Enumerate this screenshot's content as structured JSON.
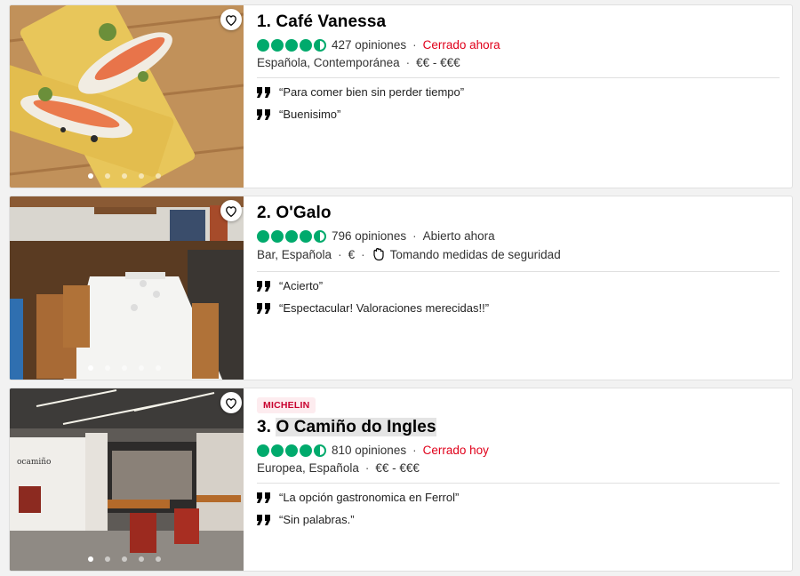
{
  "restaurants": [
    {
      "title": "1. Café Vanessa",
      "reviews": "427 opiniones",
      "status": "Cerrado ahora",
      "cuisine": "Española, Contemporánea",
      "price": "€€ - €€€",
      "quotes": [
        "“Para comer bien sin perder tiempo”",
        "“Buenisimo”"
      ]
    },
    {
      "title": "2. O'Galo",
      "reviews": "796 opiniones",
      "status": "Abierto ahora",
      "cuisine": "Bar, Española",
      "price": "€",
      "safety": "Tomando medidas de seguridad",
      "quotes": [
        "“Acierto”",
        "“Espectacular! Valoraciones merecidas!!”"
      ]
    },
    {
      "badge": "MICHELIN",
      "title_prefix": "3. ",
      "title_name": "O Camiño do Ingles",
      "reviews": "810 opiniones",
      "status": "Cerrado hoy",
      "cuisine": "Europea, Española",
      "price": "€€ - €€€",
      "quotes": [
        "“La opción gastronomica en Ferrol”",
        "“Sin palabras.”"
      ]
    }
  ],
  "separator": "·",
  "colors": {
    "rating_green": "#00aa6c",
    "closed_red": "#e0001a",
    "badge_red": "#c8002e"
  },
  "icons": [
    "heart-outline-icon",
    "rating-bubble-icon",
    "quote-icon",
    "hand-wash-icon"
  ]
}
